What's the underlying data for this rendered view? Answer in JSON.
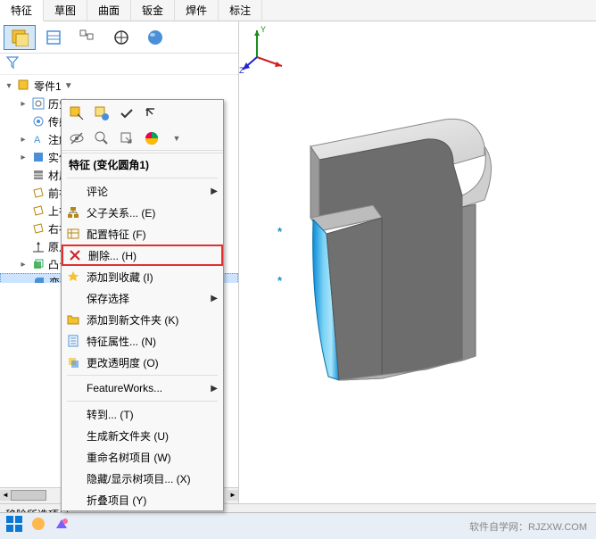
{
  "top_tabs": [
    "特征",
    "草图",
    "曲面",
    "钣金",
    "焊件",
    "标注"
  ],
  "active_tab_index": 0,
  "tree": {
    "root": "零件1",
    "items": [
      {
        "label": "历史"
      },
      {
        "label": "传感"
      },
      {
        "label": "注解"
      },
      {
        "label": "实体"
      },
      {
        "label": "材质"
      },
      {
        "label": "前视"
      },
      {
        "label": "上视"
      },
      {
        "label": "右视"
      },
      {
        "label": "原点"
      },
      {
        "label": "凸台"
      },
      {
        "label": "变化"
      },
      {
        "label": "圆角"
      }
    ]
  },
  "ctx": {
    "header": "特征 (变化圆角1)",
    "items": [
      {
        "label": "评论",
        "arrow": true,
        "icon": null
      },
      {
        "label": "父子关系... (E)",
        "icon": "parent"
      },
      {
        "label": "配置特征 (F)",
        "icon": "config"
      },
      {
        "label": "删除... (H)",
        "icon": "delete",
        "highlighted": true
      },
      {
        "label": "添加到收藏 (I)",
        "icon": "star"
      },
      {
        "label": "保存选择",
        "arrow": true
      },
      {
        "label": "添加到新文件夹 (K)",
        "icon": "folder"
      },
      {
        "label": "特征属性... (N)",
        "icon": "props"
      },
      {
        "label": "更改透明度 (O)",
        "icon": "trans"
      },
      {
        "label": "FeatureWorks...",
        "arrow": true
      },
      {
        "label": "转到... (T)"
      },
      {
        "label": "生成新文件夹 (U)"
      },
      {
        "label": "重命名树项目 (W)"
      },
      {
        "label": "隐藏/显示树项目... (X)"
      },
      {
        "label": "折叠项目 (Y)"
      }
    ]
  },
  "status": "移除所选项目",
  "watermark": "软件自学网：RJZXW.COM"
}
